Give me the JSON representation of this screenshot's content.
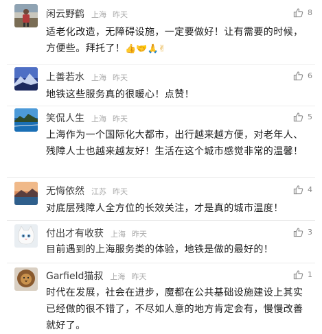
{
  "comments": [
    {
      "username": "闲云野鹤",
      "location": "上海",
      "time": "昨天",
      "likes": "8",
      "text": "适老化改造，无障碍设施，一定要做好！让有需要的时候，方便些。拜托了！",
      "emoji": "👍🤝🙏✌",
      "avatar_icon": "person-photo-icon"
    },
    {
      "username": "上善若水",
      "location": "上海",
      "time": "昨天",
      "likes": "6",
      "text": "地铁这些服务真的很暖心！点赞！",
      "avatar_icon": "mountain-landscape-icon"
    },
    {
      "username": "笑侃人生",
      "location": "上海",
      "time": "昨天",
      "likes": "5",
      "text": "上海作为一个国际化大都市，出行越来越方便，对老年人、残障人士也越来越友好！生活在这个城市感觉非常的温馨！",
      "avatar_icon": "lake-landscape-icon"
    },
    {
      "username": "无悔依然",
      "location": "江苏",
      "time": "昨天",
      "likes": "4",
      "text": "对底层残障人全方位的长效关注，才是真的城市温度！",
      "avatar_icon": "sunset-landscape-icon"
    },
    {
      "username": "付出才有收获",
      "location": "上海",
      "time": "昨天",
      "likes": "3",
      "text": "目前遇到的上海服务类的体验，地铁是做的最好的！",
      "avatar_icon": "white-cat-icon"
    },
    {
      "username": "Garfield猫叔",
      "location": "上海",
      "time": "昨天",
      "likes": "1",
      "text": "时代在发展，社会在进步，魔都在公共基础设施建设上其实已经做的很不错了，不尽如人意的地方肯定会有，慢慢改善就好了。",
      "avatar_icon": "lion-icon"
    }
  ],
  "colors": {
    "username": "#3a3a3a",
    "meta": "#a8a8a8",
    "body_text": "#1e1e1e",
    "divider": "#ececec"
  }
}
